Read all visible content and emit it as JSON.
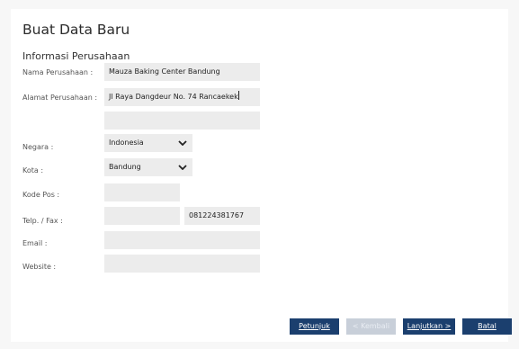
{
  "header": {
    "title": "Buat Data Baru"
  },
  "section": {
    "title": "Informasi Perusahaan"
  },
  "form": {
    "company_name": {
      "label": "Nama Perusahaan :",
      "value": "Mauza Baking Center Bandung"
    },
    "address": {
      "label": "Alamat Perusahaan :",
      "value": "Jl Raya Dangdeur No. 74 Rancaekek",
      "value2": ""
    },
    "country": {
      "label": "Negara :",
      "value": "Indonesia"
    },
    "city": {
      "label": "Kota :",
      "value": "Bandung"
    },
    "postal_code": {
      "label": "Kode Pos :",
      "value": ""
    },
    "phone_fax": {
      "label": "Telp. / Fax :",
      "phone": "",
      "fax": "081224381767"
    },
    "email": {
      "label": "Email :",
      "value": ""
    },
    "website": {
      "label": "Website :",
      "value": ""
    }
  },
  "buttons": {
    "help": "Petunjuk",
    "back": "< Kembali",
    "next": "Lanjutkan >",
    "cancel": "Batal"
  },
  "colors": {
    "button_primary": "#1b3f6e",
    "button_disabled": "#c8cfd9",
    "field_bg": "#ececec"
  },
  "icons": {
    "dropdown": "chevron-down-icon"
  }
}
